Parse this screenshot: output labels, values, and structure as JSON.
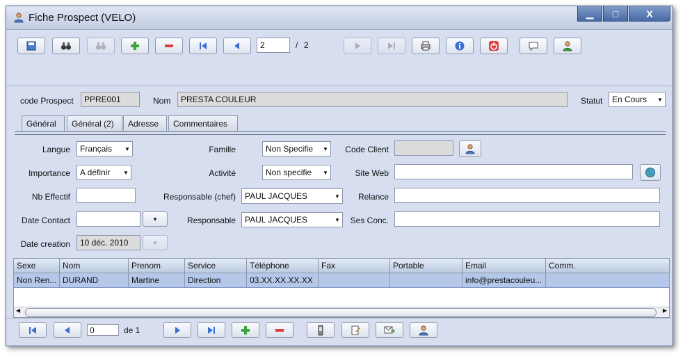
{
  "window": {
    "title": "Fiche Prospect (VELO)",
    "minimize": "▁",
    "maximize": "□",
    "close": "X"
  },
  "toolbar": {
    "page_current": "2",
    "page_separator": "/",
    "page_total": "2"
  },
  "header": {
    "code_label": "code Prospect",
    "code_value": "PPRE001",
    "nom_label": "Nom",
    "nom_value": "PRESTA COULEUR",
    "statut_label": "Statut",
    "statut_value": "En Cours"
  },
  "tabs": [
    {
      "label": "Général",
      "active": true
    },
    {
      "label": "Général (2)",
      "active": false
    },
    {
      "label": "Adresse",
      "active": false
    },
    {
      "label": "Commentaires",
      "active": false
    }
  ],
  "form": {
    "langue_label": "Langue",
    "langue_value": "Français",
    "importance_label": "Importance",
    "importance_value": "A définir",
    "nb_effectif_label": "Nb Effectif",
    "nb_effectif_value": "",
    "date_contact_label": "Date Contact",
    "date_contact_value": "",
    "date_creation_label": "Date creation",
    "date_creation_value": "10 déc. 2010",
    "famille_label": "Famille",
    "famille_value": "Non Specifie",
    "activite_label": "Activité",
    "activite_value": "Non specifie",
    "responsable_chef_label": "Responsable (chef)",
    "responsable_chef_value": "PAUL JACQUES",
    "responsable_label": "Responsable",
    "responsable_value": "PAUL JACQUES",
    "code_client_label": "Code Client",
    "code_client_value": "",
    "site_web_label": "Site Web",
    "site_web_value": "",
    "relance_label": "Relance",
    "relance_value": "",
    "ses_conc_label": "Ses Conc.",
    "ses_conc_value": ""
  },
  "contacts": {
    "columns": [
      "Sexe",
      "Nom",
      "Prenom",
      "Service",
      "Téléphone",
      "Fax",
      "Portable",
      "Email",
      "Comm."
    ],
    "rows": [
      [
        "Non Ren...",
        "DURAND",
        "Martine",
        "Direction",
        "03.XX.XX.XX.XX",
        "",
        "",
        "info@prestacouleu...",
        ""
      ]
    ]
  },
  "bottombar": {
    "page_current": "0",
    "page_of": "de 1"
  },
  "colors": {
    "window_bg": "#d6def0",
    "selected_row": "#b6c8ea",
    "accent_red": "#d94040",
    "accent_green": "#3aa53a",
    "accent_blue": "#3a6ed0"
  }
}
